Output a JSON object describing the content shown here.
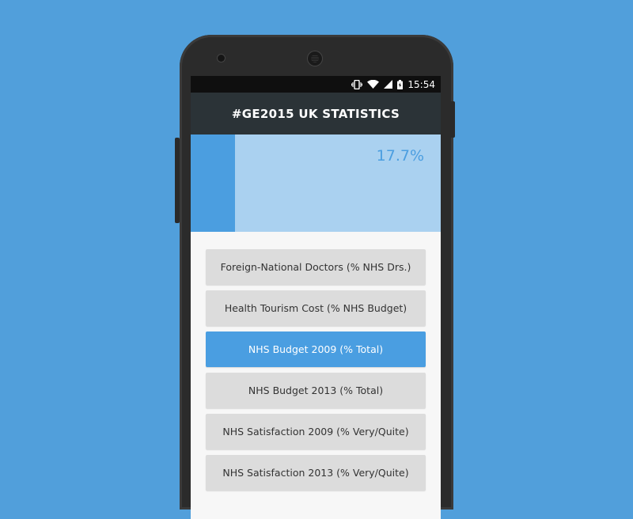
{
  "status_bar": {
    "time": "15:54",
    "icons": [
      "vibrate-icon",
      "wifi-icon",
      "signal-icon",
      "battery-charging-icon"
    ]
  },
  "app_bar": {
    "title": "#GE2015 UK STATISTICS"
  },
  "stat_panel": {
    "value_text": "17.7%",
    "fill_fraction": 0.177
  },
  "list": {
    "items": [
      {
        "label": "Foreign-National Doctors (% NHS Drs.)",
        "selected": false
      },
      {
        "label": "Health Tourism Cost (% NHS Budget)",
        "selected": false
      },
      {
        "label": "NHS Budget 2009 (% Total)",
        "selected": true
      },
      {
        "label": "NHS Budget 2013 (% Total)",
        "selected": false
      },
      {
        "label": "NHS Satisfaction 2009 (% Very/Quite)",
        "selected": false
      },
      {
        "label": "NHS Satisfaction 2013 (% Very/Quite)",
        "selected": false
      }
    ]
  },
  "colors": {
    "background": "#519fdb",
    "accent": "#4a9ee1",
    "app_bar": "#2b3337",
    "stat_panel": "#aad1f0"
  }
}
